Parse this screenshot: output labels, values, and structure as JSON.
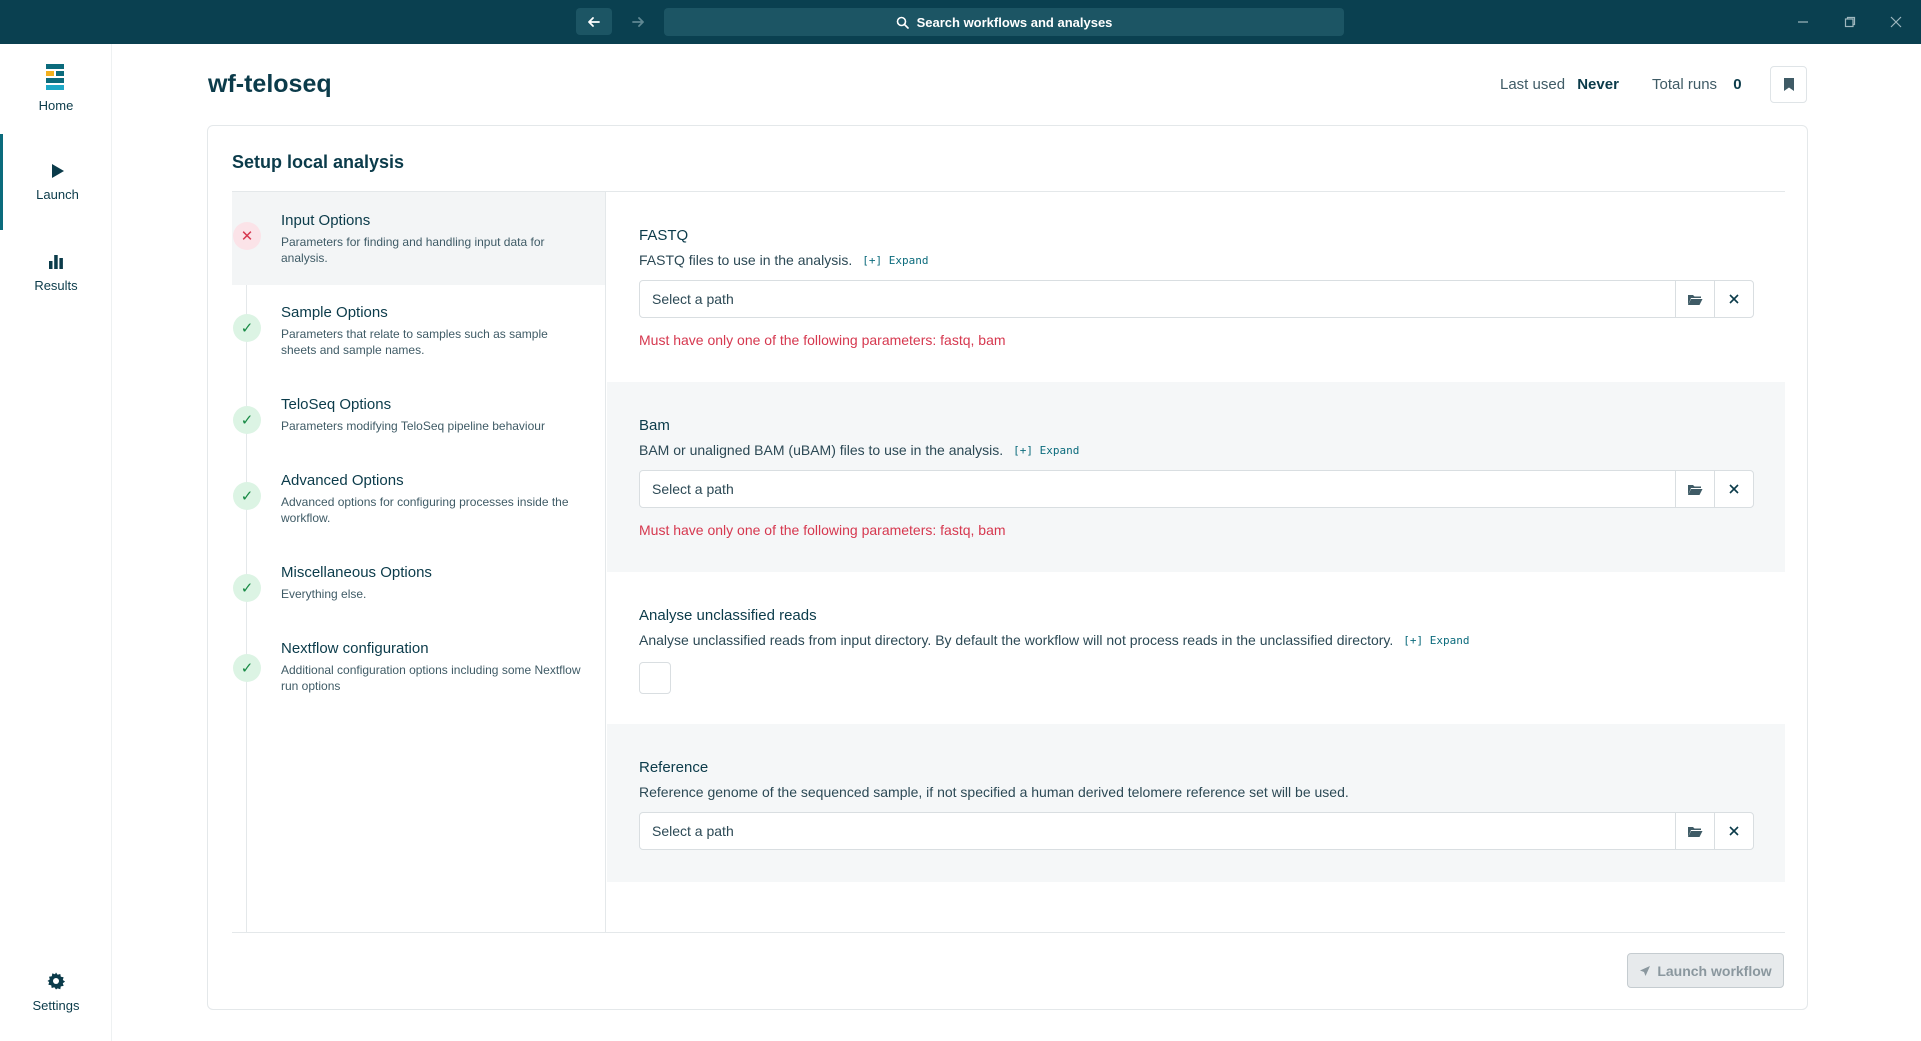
{
  "titlebar": {
    "search_placeholder": "Search workflows and analyses"
  },
  "sidebar": {
    "items": [
      {
        "label": "Home"
      },
      {
        "label": "Launch"
      },
      {
        "label": "Results"
      },
      {
        "label": "Settings"
      }
    ]
  },
  "header": {
    "title": "wf-teloseq",
    "last_used_label": "Last used",
    "last_used_value": "Never",
    "total_runs_label": "Total runs",
    "total_runs_value": "0"
  },
  "card": {
    "title": "Setup local analysis",
    "steps": [
      {
        "title": "Input Options",
        "desc": "Parameters for finding and handling input data for analysis.",
        "status": "error"
      },
      {
        "title": "Sample Options",
        "desc": "Parameters that relate to samples such as sample sheets and sample names.",
        "status": "ok"
      },
      {
        "title": "TeloSeq Options",
        "desc": "Parameters modifying TeloSeq pipeline behaviour",
        "status": "ok"
      },
      {
        "title": "Advanced Options",
        "desc": "Advanced options for configuring processes inside the workflow.",
        "status": "ok"
      },
      {
        "title": "Miscellaneous Options",
        "desc": "Everything else.",
        "status": "ok"
      },
      {
        "title": "Nextflow configuration",
        "desc": "Additional configuration options including some Nextflow run options",
        "status": "ok"
      }
    ],
    "fields": {
      "fastq": {
        "label": "FASTQ",
        "desc": "FASTQ files to use in the analysis.",
        "expand": "[+] Expand",
        "placeholder": "Select a path",
        "error": "Must have only one of the following parameters: fastq, bam"
      },
      "bam": {
        "label": "Bam",
        "desc": "BAM or unaligned BAM (uBAM) files to use in the analysis.",
        "expand": "[+] Expand",
        "placeholder": "Select a path",
        "error": "Must have only one of the following parameters: fastq, bam"
      },
      "unclassified": {
        "label": "Analyse unclassified reads",
        "desc": "Analyse unclassified reads from input directory. By default the workflow will not process reads in the unclassified directory.",
        "expand": "[+] Expand",
        "checked": false
      },
      "reference": {
        "label": "Reference",
        "desc": "Reference genome of the sequenced sample, if not specified a human derived telomere reference set will be used.",
        "placeholder": "Select a path"
      }
    },
    "launch_label": "Launch workflow"
  },
  "colors": {
    "titlebar": "#0a4050",
    "primary_text": "#0b3b4a",
    "error": "#d6384f",
    "success": "#178a45",
    "accent": "#0b6b7c"
  },
  "icons": [
    "back-arrow-icon",
    "forward-arrow-icon",
    "search-icon",
    "minimize-icon",
    "maximize-icon",
    "close-icon",
    "home-logo-icon",
    "play-icon",
    "bar-chart-icon",
    "gear-icon",
    "bookmark-icon",
    "folder-icon",
    "clear-icon",
    "rocket-icon"
  ]
}
